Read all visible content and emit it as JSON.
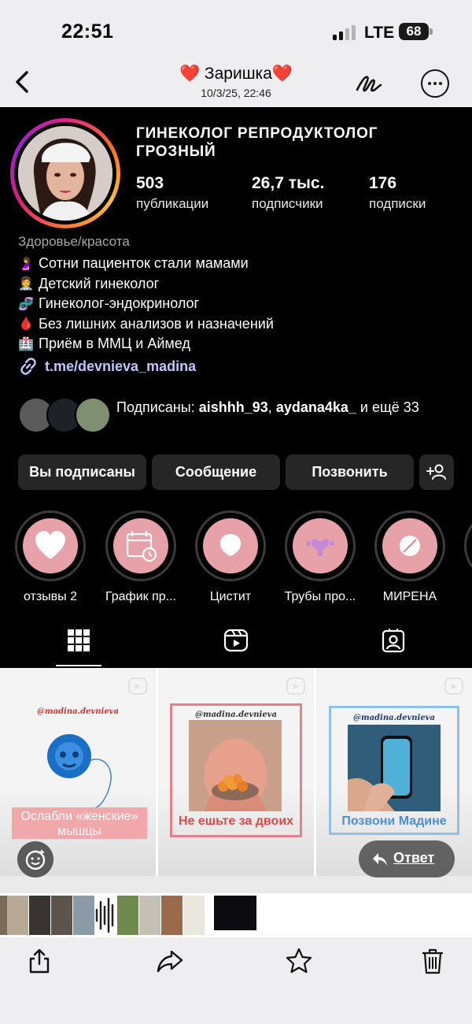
{
  "status_bar": {
    "time": "22:51",
    "network": "LTE",
    "battery": "68"
  },
  "header": {
    "title": "❤️ Заришка❤️",
    "date": "10/3/25, 22:46"
  },
  "profile": {
    "name": "ГИНЕКОЛОГ  РЕПРОДУКТОЛОГ ГРОЗНЫЙ",
    "stats": [
      {
        "value": "503",
        "label": "публикации"
      },
      {
        "value": "26,7 тыс.",
        "label": "подписчики"
      },
      {
        "value": "176",
        "label": "подписки"
      }
    ],
    "category": "Здоровье/красота",
    "bio": [
      {
        "emoji": "🤰",
        "text": "Сотни пациенток стали мамами"
      },
      {
        "emoji": "👩‍⚕️",
        "text": "Детский гинеколог"
      },
      {
        "emoji": "🧬",
        "text": "Гинеколог-эндокринолог"
      },
      {
        "emoji": "🩸",
        "text": "Без лишних анализов и назначений"
      },
      {
        "emoji": "🏥",
        "text": "Приём в ММЦ и Аймед"
      }
    ],
    "link": "t.me/devnieva_madina",
    "followed_by": {
      "prefix": "Подписаны: ",
      "user1": "aishhh_93",
      "separator": ", ",
      "user2": "aydana4ka_",
      "suffix": " и ещё 33"
    },
    "buttons": {
      "following": "Вы подписаны",
      "message": "Сообщение",
      "call": "Позвонить"
    },
    "highlights": [
      {
        "label": "отзывы 2",
        "icon": "heart-icon"
      },
      {
        "label": "График пр...",
        "icon": "calendar-icon"
      },
      {
        "label": "Цистит",
        "icon": "bubble-icon"
      },
      {
        "label": "Трубы про...",
        "icon": "uterus-icon"
      },
      {
        "label": "МИРЕНА",
        "icon": "pill-icon"
      }
    ]
  },
  "grid": {
    "posts": [
      {
        "handle": "@madina.devnieva",
        "caption": "Ослабли «женские» мышцы"
      },
      {
        "handle": "@madina.devnieva",
        "caption": "Не ешьте за двоих"
      },
      {
        "handle": "@madina.devnieva",
        "caption": "Позвони Мадине"
      }
    ]
  },
  "reply": {
    "label": "Ответ"
  },
  "colors": {
    "profile_bg": "#000000",
    "button_bg": "#262626",
    "highlight_fill": "#e6a2a8",
    "link": "#c0c6ff",
    "caption_red": "#e04848",
    "caption_blue": "#4a8fd8"
  }
}
